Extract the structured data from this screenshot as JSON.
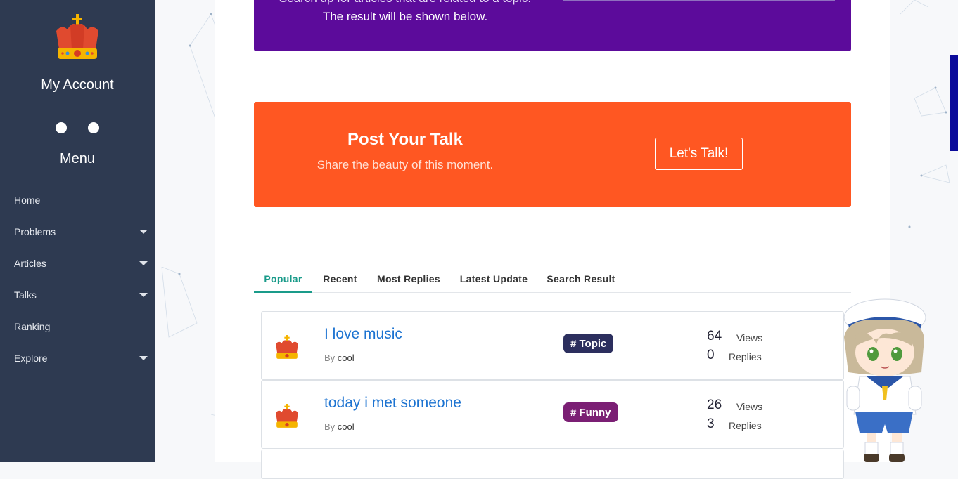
{
  "sidebar": {
    "account_title": "My Account",
    "menu_title": "Menu",
    "items": [
      {
        "label": "Home",
        "has_caret": false
      },
      {
        "label": "Problems",
        "has_caret": true
      },
      {
        "label": "Articles",
        "has_caret": true
      },
      {
        "label": "Talks",
        "has_caret": true
      },
      {
        "label": "Ranking",
        "has_caret": false
      },
      {
        "label": "Explore",
        "has_caret": true
      }
    ]
  },
  "search_banner": {
    "line1": "Search up for articles that are related to a topic.",
    "line2": "The result will be shown below.",
    "color": "#5c0b9b"
  },
  "talk_banner": {
    "title": "Post Your Talk",
    "subtitle": "Share the beauty of this moment.",
    "button_label": "Let's Talk!",
    "color": "#ff5722"
  },
  "tabs": [
    {
      "label": "Popular",
      "active": true
    },
    {
      "label": "Recent",
      "active": false
    },
    {
      "label": "Most Replies",
      "active": false
    },
    {
      "label": "Latest Update",
      "active": false
    },
    {
      "label": "Search Result",
      "active": false
    }
  ],
  "posts": [
    {
      "title": "I love music",
      "by_label": "By",
      "author": "cool",
      "tag": "# Topic",
      "tag_color": "#2c2f5e",
      "views": "64",
      "views_label": "Views",
      "replies": "0",
      "replies_label": "Replies"
    },
    {
      "title": "today i met someone",
      "by_label": "By",
      "author": "cool",
      "tag": "# Funny",
      "tag_color": "#7b1f74",
      "views": "26",
      "views_label": "Views",
      "replies": "3",
      "replies_label": "Replies"
    }
  ],
  "colors": {
    "sidebar_bg": "#2e3a51",
    "active_tab": "#1a9b8a",
    "link": "#1c73d1"
  }
}
